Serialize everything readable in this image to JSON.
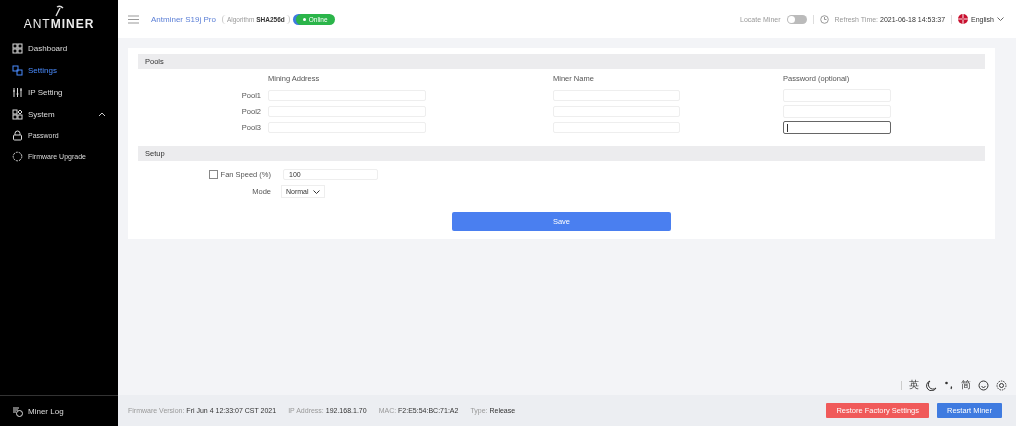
{
  "sidebar": {
    "logo": "ANT**MINER**",
    "items": [
      {
        "label": "Dashboard",
        "selected": false
      },
      {
        "label": "Settings",
        "selected": true
      },
      {
        "label": "IP Setting",
        "selected": false
      },
      {
        "label": "System",
        "selected": false,
        "expanded": true,
        "children": [
          {
            "label": "Password",
            "selected": false
          },
          {
            "label": "Firmware Upgrade",
            "selected": false
          }
        ]
      }
    ],
    "miner_log": "Miner Log"
  },
  "header": {
    "model": "Antminer S19j Pro",
    "algorithm_label": "Algorithm",
    "algorithm": "SHA256d",
    "status": "Online",
    "locate_label": "Locate Miner",
    "locate_on": false,
    "refresh_label": "Refresh Time:",
    "refresh_time": "2021-06-18 14:53:37",
    "language": "English"
  },
  "pools": {
    "title": "Pools",
    "columns": [
      "Mining Address",
      "Miner Name",
      "Password (optional)"
    ],
    "rows": [
      {
        "label": "Pool1",
        "password_focused": false
      },
      {
        "label": "Pool2",
        "password_focused": false
      },
      {
        "label": "Pool3",
        "password_focused": true
      }
    ]
  },
  "setup": {
    "title": "Setup",
    "fan_label": "Fan Speed (%)",
    "fan_checked": false,
    "fan_value": "100",
    "mode_label": "Mode",
    "mode_value": "Normal"
  },
  "save": "Save",
  "ime_items": [
    {
      "kind": "text",
      "text": "英"
    },
    {
      "kind": "moon"
    },
    {
      "kind": "punct"
    },
    {
      "kind": "text",
      "text": "简"
    },
    {
      "kind": "smile"
    },
    {
      "kind": "gear"
    }
  ],
  "footer": {
    "fields": [
      {
        "label": "Firmware Version:",
        "value": "Fri Jun 4 12:33:07 CST 2021"
      },
      {
        "label": "IP Address:",
        "value": "192.168.1.70"
      },
      {
        "label": "MAC:",
        "value": "F2:E5:54:BC:71:A2"
      },
      {
        "label": "Type:",
        "value": "Release"
      }
    ],
    "buttons": [
      {
        "label": "Restore Factory Settings",
        "kind": "danger"
      },
      {
        "label": "Restart Miner",
        "kind": "primary"
      }
    ]
  }
}
